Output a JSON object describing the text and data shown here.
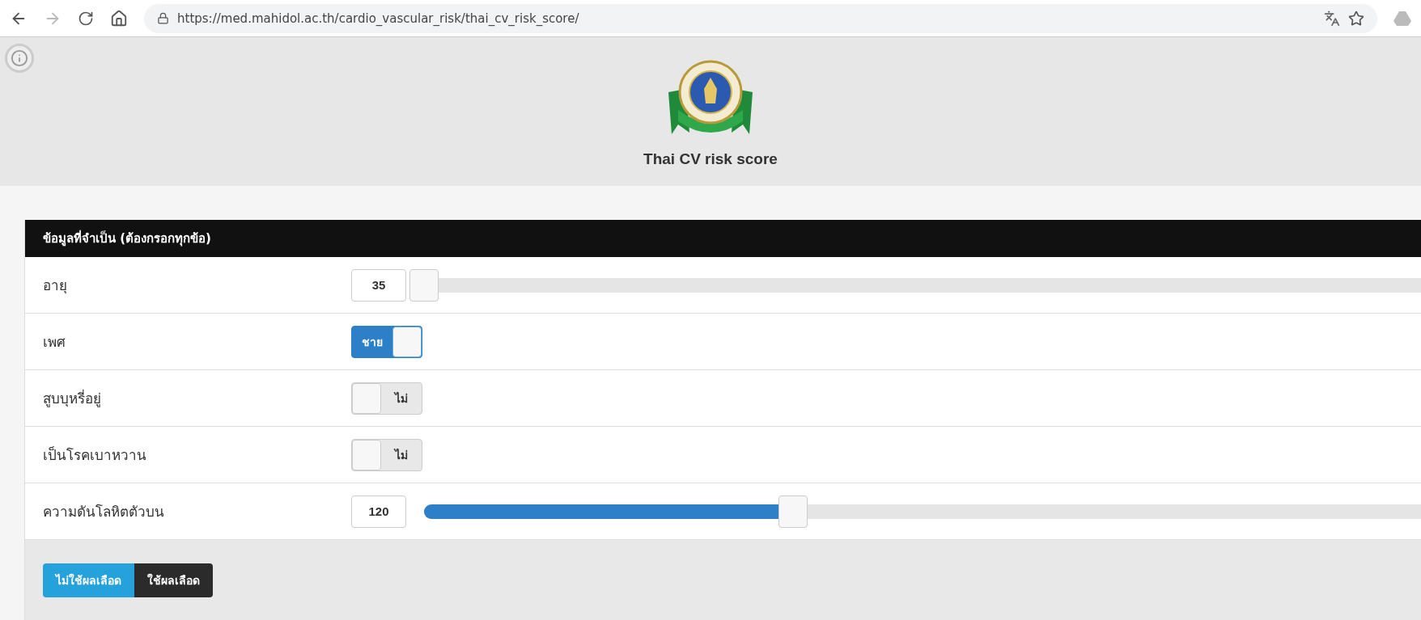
{
  "browser": {
    "url": "https://med.mahidol.ac.th/cardio_vascular_risk/thai_cv_risk_score/"
  },
  "header": {
    "title": "Thai CV risk score"
  },
  "panel": {
    "title": "ข้อมูลที่จำเป็น (ต้องกรอกทุกข้อ)",
    "rows": [
      {
        "kind": "slider",
        "label": "อายุ",
        "value": "35",
        "level": 0
      },
      {
        "kind": "toggle",
        "label": "เพศ",
        "on": true,
        "state_label": "ชาย"
      },
      {
        "kind": "toggle",
        "label": "สูบบุหรี่อยู่",
        "on": false,
        "state_label": "ไม่"
      },
      {
        "kind": "toggle",
        "label": "เป็นโรคเบาหวาน",
        "on": false,
        "state_label": "ไม่"
      },
      {
        "kind": "slider",
        "label": "ความดันโลหิตตัวบน",
        "value": "120",
        "level": 0.37
      }
    ]
  },
  "modes": [
    {
      "label": "ไม่ใช้ผลเลือด",
      "selected": true
    },
    {
      "label": "ใช้ผลเลือด",
      "selected": false
    }
  ]
}
